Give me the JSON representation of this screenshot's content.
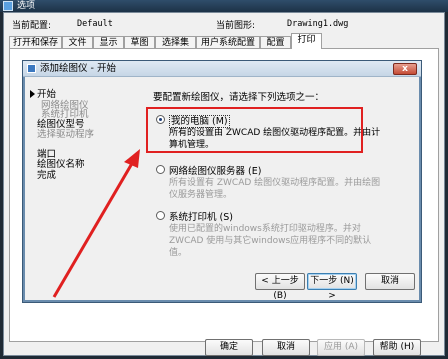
{
  "window": {
    "title": "选项"
  },
  "config": {
    "current_profile_label": "当前配置:",
    "current_profile_value": "Default",
    "current_drawing_label": "当前图形:",
    "current_drawing_value": "Drawing1.dwg"
  },
  "tabs": [
    {
      "label": "打开和保存"
    },
    {
      "label": "文件"
    },
    {
      "label": "显示"
    },
    {
      "label": "草图"
    },
    {
      "label": "选择集"
    },
    {
      "label": "用户系统配置"
    },
    {
      "label": "配置"
    },
    {
      "label": "打印"
    }
  ],
  "bottom_buttons": {
    "ok": "确定",
    "cancel": "取消",
    "apply": "应用 (A)",
    "help": "帮助 (H)"
  },
  "wizard": {
    "title": "添加绘图仪 - 开始",
    "close": "x",
    "steps": {
      "start": "开始",
      "plotter_name_local": "网络绘图仪",
      "system_printer": "系统打印机",
      "plotter_model": "绘图仪型号",
      "select_driver": "选择驱动程序",
      "port": "端口",
      "plotter_name": "绘图仪名称",
      "finish": "完成"
    },
    "prompt": "要配置新绘图仪，请选择下列选项之一：",
    "options": {
      "my_computer": {
        "label": "我的电脑 (M)",
        "desc": "所有的设置由 ZWCAD 绘图仪驱动程序配置。并由计算机管理。",
        "selected": true
      },
      "network_server": {
        "label": "网络绘图仪服务器 (E)",
        "desc": "所有设置有 ZWCAD 绘图仪驱动程序配置。并由绘图仪服务器管理。"
      },
      "system_printer": {
        "label": "系统打印机 (S)",
        "desc": "使用已配置的windows系统打印驱动程序。并对 ZWCAD 使用与其它windows应用程序不同的默认值。"
      }
    },
    "buttons": {
      "back": "< 上一步 (B)",
      "next": "下一步 (N) >",
      "cancel": "取消"
    }
  },
  "colors": {
    "annotation_red": "#e02020",
    "title_blue": "#2f4d6a"
  }
}
